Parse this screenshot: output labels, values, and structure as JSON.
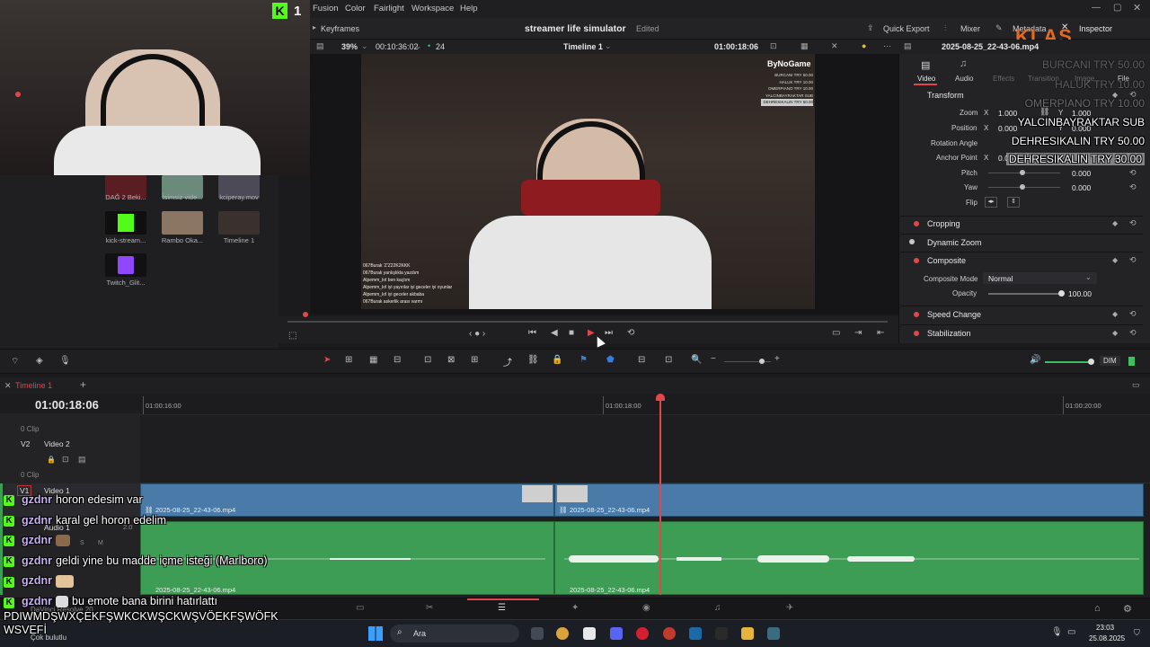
{
  "menu": {
    "items": [
      "Fusion",
      "Color",
      "Fairlight",
      "Workspace",
      "Help"
    ]
  },
  "stream_badge": {
    "k": "K",
    "count": "1"
  },
  "subbar": {
    "keyframes": "Keyframes",
    "project_title": "streamer life simulator",
    "edited": "Edited",
    "quick_export": "Quick Export",
    "mixer": "Mixer",
    "metadata": "Metadata",
    "inspector": "Inspector",
    "klas_logo": "KLAS"
  },
  "viewer": {
    "zoom": "39%",
    "timecode_left": "00:10:36:02",
    "fps": "24",
    "timeline_name": "Timeline 1",
    "timecode_right": "01:00:18:06",
    "clip_name": "2025-08-25_22-43-06.mp4",
    "brand": "ByNoGame",
    "donation_mini": [
      "BURCANI TRY 50.00",
      "HALUK TRY 10.00",
      "OMERPIANO TRY 10.00",
      "YALCINBAYRAKTAR SUB",
      "DEHRESIKALIN TRY 50.00"
    ],
    "chat_mini": [
      "067Burak 'Z'Z22K2KKK",
      "067Burak yanlışlıkla yazdım",
      "Alpemm_krl ben kaçtım",
      "Alpemm_krl iyi yayınlar iyi geceler iyi oyunlar",
      "Alpemm_krl iyi geceler akbaba",
      "067Burak askerlik arası varmı"
    ]
  },
  "media_pool": {
    "items": [
      {
        "label": "DAĞ 2 Beki..."
      },
      {
        "label": "İsimsiz vide..."
      },
      {
        "label": "kciperay.mov"
      },
      {
        "label": "kick-stream..."
      },
      {
        "label": "Rambo Oka..."
      },
      {
        "label": "Timeline 1"
      },
      {
        "label": "Twitch_Glit..."
      }
    ]
  },
  "inspector": {
    "tabs": [
      "Video",
      "Audio",
      "Effects",
      "Transition",
      "Image",
      "File"
    ],
    "transform": {
      "title": "Transform",
      "zoom_label": "Zoom",
      "zoom_x": "1.000",
      "zoom_y": "1.000",
      "position_label": "Position",
      "position_x": "0.000",
      "position_y": "0.000",
      "rotation_label": "Rotation Angle",
      "anchor_label": "Anchor Point",
      "anchor_x": "0.000",
      "pitch_label": "Pitch",
      "pitch_val": "0.000",
      "yaw_label": "Yaw",
      "yaw_val": "0.000",
      "flip_label": "Flip",
      "x": "X",
      "y": "Y"
    },
    "cropping": "Cropping",
    "dynamic_zoom": "Dynamic Zoom",
    "composite": {
      "title": "Composite",
      "mode_label": "Composite Mode",
      "mode_value": "Normal",
      "opacity_label": "Opacity",
      "opacity_value": "100.00"
    },
    "speed_change": "Speed Change",
    "stabilization": "Stabilization"
  },
  "donations": [
    {
      "text": "BURCANI TRY 50.00"
    },
    {
      "text": "HALUK TRY 10.00"
    },
    {
      "text": "OMERPIANO TRY 10.00"
    },
    {
      "text": "YALCINBAYRAKTAR SUB"
    },
    {
      "text": "DEHRESIKALIN TRY 50.00"
    },
    {
      "text": "DEHRESIKALIN TRY 30.00"
    }
  ],
  "toolbar": {
    "dim": "DIM"
  },
  "timeline": {
    "tab": "Timeline 1",
    "timecode": "01:00:18:06",
    "ruler": [
      "01:00:16:00",
      "01:00:18:00",
      "01:00:20:00"
    ],
    "v2_clip": "0 Clip",
    "v2_id": "V2",
    "v2_name": "Video 2",
    "v1_clip": "0 Clip",
    "v1_id": "V1",
    "v1_name": "Video 1",
    "a1_name": "Audio 1",
    "a1_level": "2.0",
    "clip_name_1": "2025-08-25_22-43-06.mp4",
    "clip_name_2": "2025-08-25_22-43-06.mp4",
    "audio_clip_1": "2025-08-25_22-43-06.mp4",
    "audio_clip_2": "2025-08-25_22-43-06.mp4"
  },
  "chat": [
    {
      "name": "gzdnr",
      "msg": "horon edesim var"
    },
    {
      "name": "gzdnr",
      "msg": "karal gel horon edelim"
    },
    {
      "name": "gzdnr",
      "msg": ""
    },
    {
      "name": "gzdnr",
      "msg": "geldi yine bu madde içme isteği (Marlboro)"
    },
    {
      "name": "gzdnr",
      "msg": ""
    },
    {
      "name": "gzdnr",
      "msg": "bu emote bana birini hatırlattı"
    }
  ],
  "chat_spam": "PDIWMDŞWXÇEKFŞWKCKWŞCKWŞVÖEKFŞWÖFK",
  "chat_spam2": "WSVEFİ",
  "pagebar": {
    "app": "DaVinci Resolve 20"
  },
  "taskbar": {
    "search": "Ara",
    "weather": "Çok bulutlu",
    "time": "23:03",
    "date": "25.08.2025"
  }
}
